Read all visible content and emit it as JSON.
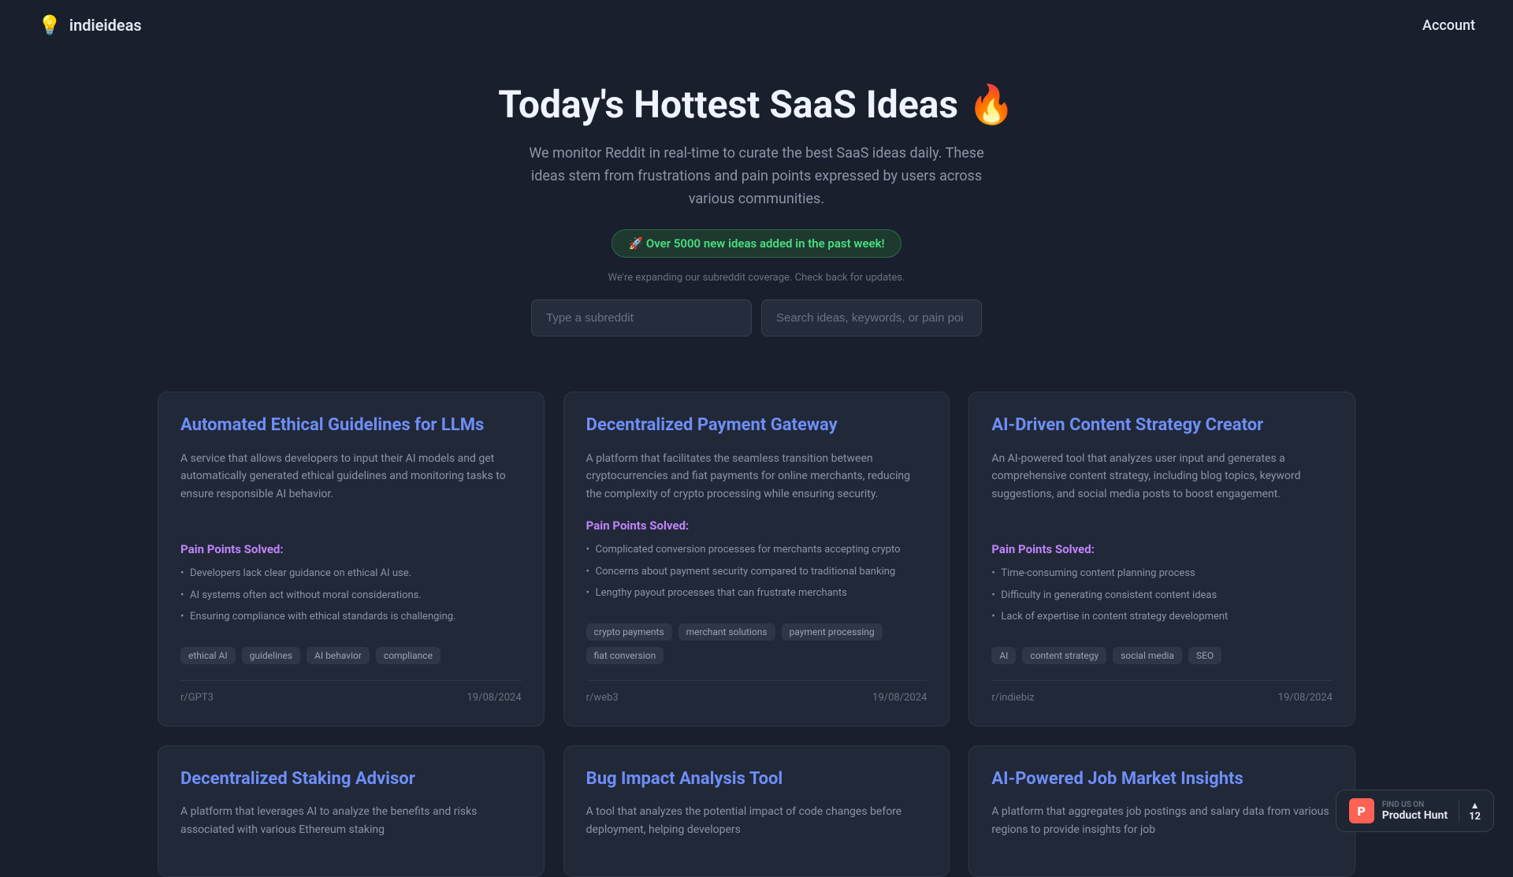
{
  "header": {
    "logo_icon": "💡",
    "logo_text": "indieideas",
    "account_label": "Account"
  },
  "hero": {
    "title": "Today's Hottest SaaS Ideas 🔥",
    "description": "We monitor Reddit in real-time to curate the best SaaS ideas daily. These ideas stem from frustrations and pain points expressed by users across various communities.",
    "promo": "🚀 Over 5000 new ideas added in the past week!",
    "notice": "We're expanding our subreddit coverage. Check back for updates.",
    "subreddit_placeholder": "Type a subreddit",
    "search_placeholder": "Search ideas, keywords, or pain poi"
  },
  "cards": [
    {
      "title": "Automated Ethical Guidelines for LLMs",
      "description": "A service that allows developers to input their AI models and get automatically generated ethical guidelines and monitoring tasks to ensure responsible AI behavior.",
      "pain_points_title": "Pain Points Solved:",
      "pain_points": [
        "Developers lack clear guidance on ethical AI use.",
        "AI systems often act without moral considerations.",
        "Ensuring compliance with ethical standards is challenging."
      ],
      "tags": [
        "ethical AI",
        "guidelines",
        "AI behavior",
        "compliance"
      ],
      "subreddit": "r/GPT3",
      "date": "19/08/2024"
    },
    {
      "title": "Decentralized Payment Gateway",
      "description": "A platform that facilitates the seamless transition between cryptocurrencies and fiat payments for online merchants, reducing the complexity of crypto processing while ensuring security.",
      "pain_points_title": "Pain Points Solved:",
      "pain_points": [
        "Complicated conversion processes for merchants accepting crypto",
        "Concerns about payment security compared to traditional banking",
        "Lengthy payout processes that can frustrate merchants"
      ],
      "tags": [
        "crypto payments",
        "merchant solutions",
        "payment processing",
        "fiat conversion"
      ],
      "subreddit": "r/web3",
      "date": "19/08/2024"
    },
    {
      "title": "AI-Driven Content Strategy Creator",
      "description": "An AI-powered tool that analyzes user input and generates a comprehensive content strategy, including blog topics, keyword suggestions, and social media posts to boost engagement.",
      "pain_points_title": "Pain Points Solved:",
      "pain_points": [
        "Time-consuming content planning process",
        "Difficulty in generating consistent content ideas",
        "Lack of expertise in content strategy development"
      ],
      "tags": [
        "AI",
        "content strategy",
        "social media",
        "SEO"
      ],
      "subreddit": "r/indiebiz",
      "date": "19/08/2024"
    },
    {
      "title": "Decentralized Staking Advisor",
      "description": "A platform that leverages AI to analyze the benefits and risks associated with various Ethereum staking",
      "pain_points_title": "",
      "pain_points": [],
      "tags": [],
      "subreddit": "",
      "date": ""
    },
    {
      "title": "Bug Impact Analysis Tool",
      "description": "A tool that analyzes the potential impact of code changes before deployment, helping developers",
      "pain_points_title": "",
      "pain_points": [],
      "tags": [],
      "subreddit": "",
      "date": ""
    },
    {
      "title": "AI-Powered Job Market Insights",
      "description": "A platform that aggregates job postings and salary data from various regions to provide insights for job",
      "pain_points_title": "",
      "pain_points": [],
      "tags": [],
      "subreddit": "",
      "date": ""
    }
  ],
  "product_hunt": {
    "find_us_label": "FIND US ON",
    "name": "Product Hunt",
    "count": "12",
    "arrow": "▲"
  }
}
